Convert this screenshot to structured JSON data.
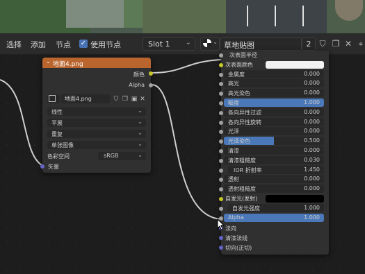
{
  "header": {
    "menu_select": "选择",
    "menu_add": "添加",
    "menu_node": "节点",
    "use_nodes_label": "使用节点",
    "use_nodes_checked": true,
    "slot": "Slot 1",
    "material_name": "草地贴图",
    "user_count": "2"
  },
  "image_node": {
    "title": "地面4.png",
    "out_color": "颜色",
    "out_alpha": "Alpha",
    "image_name": "地面4.png",
    "interpolation": "线性",
    "projection": "平展",
    "extension": "重复",
    "source": "单张图像",
    "colorspace_label": "色彩空间",
    "colorspace_value": "sRGB",
    "in_vector": "矢量"
  },
  "bsdf": {
    "rows": [
      {
        "label": "次表面半径",
        "value": "",
        "kind": "cut"
      },
      {
        "label": "次表面颜色",
        "value": "",
        "kind": "color",
        "color": "#f2f2f2"
      },
      {
        "label": "金属度",
        "value": "0.000",
        "kind": "num"
      },
      {
        "label": "高光",
        "value": "0.000",
        "kind": "num"
      },
      {
        "label": "高光染色",
        "value": "0.000",
        "kind": "num"
      },
      {
        "label": "糙度",
        "value": "1.000",
        "kind": "full"
      },
      {
        "label": "各向异性过滤",
        "value": "0.000",
        "kind": "num"
      },
      {
        "label": "各向异性旋转",
        "value": "0.000",
        "kind": "num"
      },
      {
        "label": "光泽",
        "value": "0.000",
        "kind": "num"
      },
      {
        "label": "光泽染色",
        "value": "0.500",
        "kind": "half",
        "fill": 0.5
      },
      {
        "label": "清漆",
        "value": "0.000",
        "kind": "num"
      },
      {
        "label": "清漆粗糙度",
        "value": "0.030",
        "kind": "num"
      },
      {
        "label": "IOR 折射率",
        "value": "1.450",
        "kind": "ior"
      },
      {
        "label": "透射",
        "value": "0.000",
        "kind": "num"
      },
      {
        "label": "透射粗糙度",
        "value": "0.000",
        "kind": "num"
      },
      {
        "label": "自发光(发射)",
        "value": "",
        "kind": "color",
        "color": "#000000"
      },
      {
        "label": "自发光强度",
        "value": "1.000",
        "kind": "num"
      },
      {
        "label": "Alpha",
        "value": "1.000",
        "kind": "full"
      }
    ],
    "in_normal": "法向",
    "in_clearcoat_normal": "清漆法线",
    "in_tangent": "切向(正切)"
  },
  "colors": {
    "accent": "#4a78b8",
    "node_header": "#b9652d",
    "socket_yellow": "#c7c729",
    "socket_grey": "#a1a1a1",
    "socket_blue": "#6363c7"
  }
}
